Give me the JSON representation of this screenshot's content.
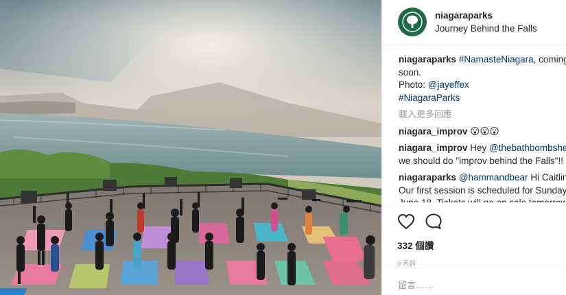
{
  "post": {
    "photo_alt": "Yoga session overlooking Niagara Falls"
  },
  "header": {
    "username": "niagaraparks",
    "location": "Journey Behind the Falls",
    "avatar_icon": "tree-icon",
    "brand_color": "#1f6b46"
  },
  "caption": {
    "user": "niagaraparks",
    "hashtag1": "#NamasteNiagara",
    "text1": ", coming",
    "text2": "soon.",
    "photo_label": "Photo: ",
    "photo_mention": "@jayeffex",
    "hashtag2": "#NiagaraParks"
  },
  "load_more": "載入更多回應",
  "comments": [
    {
      "user": "niagara_improv",
      "text": " 😮😮😮"
    },
    {
      "user": "niagara_improv",
      "text_pre": " Hey ",
      "mention": "@thebathbombshe",
      "line2": "we should do \"improv behind the Falls\"!!"
    },
    {
      "user": "niagaraparks",
      "mention": " @hammandbear",
      "text": " Hi Caitlin",
      "line2": "Our first session is scheduled for Sunday",
      "line3": "June 18. Tickets will go on sale tomorrow"
    }
  ],
  "actions": {
    "like_icon": "heart-icon",
    "comment_icon": "comment-bubble-icon"
  },
  "likes": "332 個讚",
  "time_ago": "5 天前",
  "add_comment_placeholder": "留言……"
}
